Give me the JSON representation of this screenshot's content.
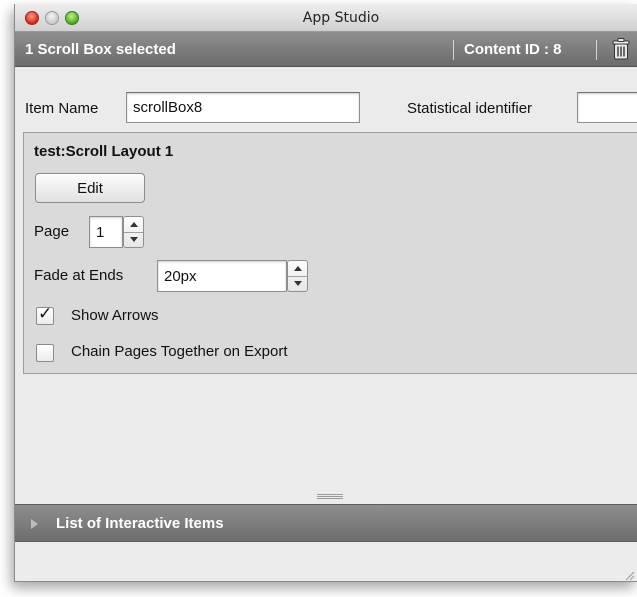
{
  "window": {
    "title": "App Studio"
  },
  "selection_bar": {
    "label": "1 Scroll Box selected",
    "content_id": "Content ID : 8",
    "trash_icon": "trash-icon"
  },
  "item_name": {
    "label": "Item Name",
    "value": "scrollBox8"
  },
  "statistical_identifier": {
    "label": "Statistical identifier",
    "value": ""
  },
  "layout_panel": {
    "title": "test:Scroll Layout 1",
    "edit_label": "Edit",
    "page": {
      "label": "Page",
      "value": "1"
    },
    "fade": {
      "label": "Fade at Ends",
      "value": "20px"
    },
    "show_arrows": {
      "label": "Show Arrows",
      "checked": true,
      "check_glyph": "✓"
    },
    "chain_pages": {
      "label": "Chain Pages Together on Export",
      "checked": false
    }
  },
  "interactive_list": {
    "label": "List of Interactive Items",
    "expanded": false
  },
  "colors": {
    "header_bar": "#7d7d7d",
    "panel_bg": "#dadada",
    "window_bg": "#ebebeb"
  }
}
